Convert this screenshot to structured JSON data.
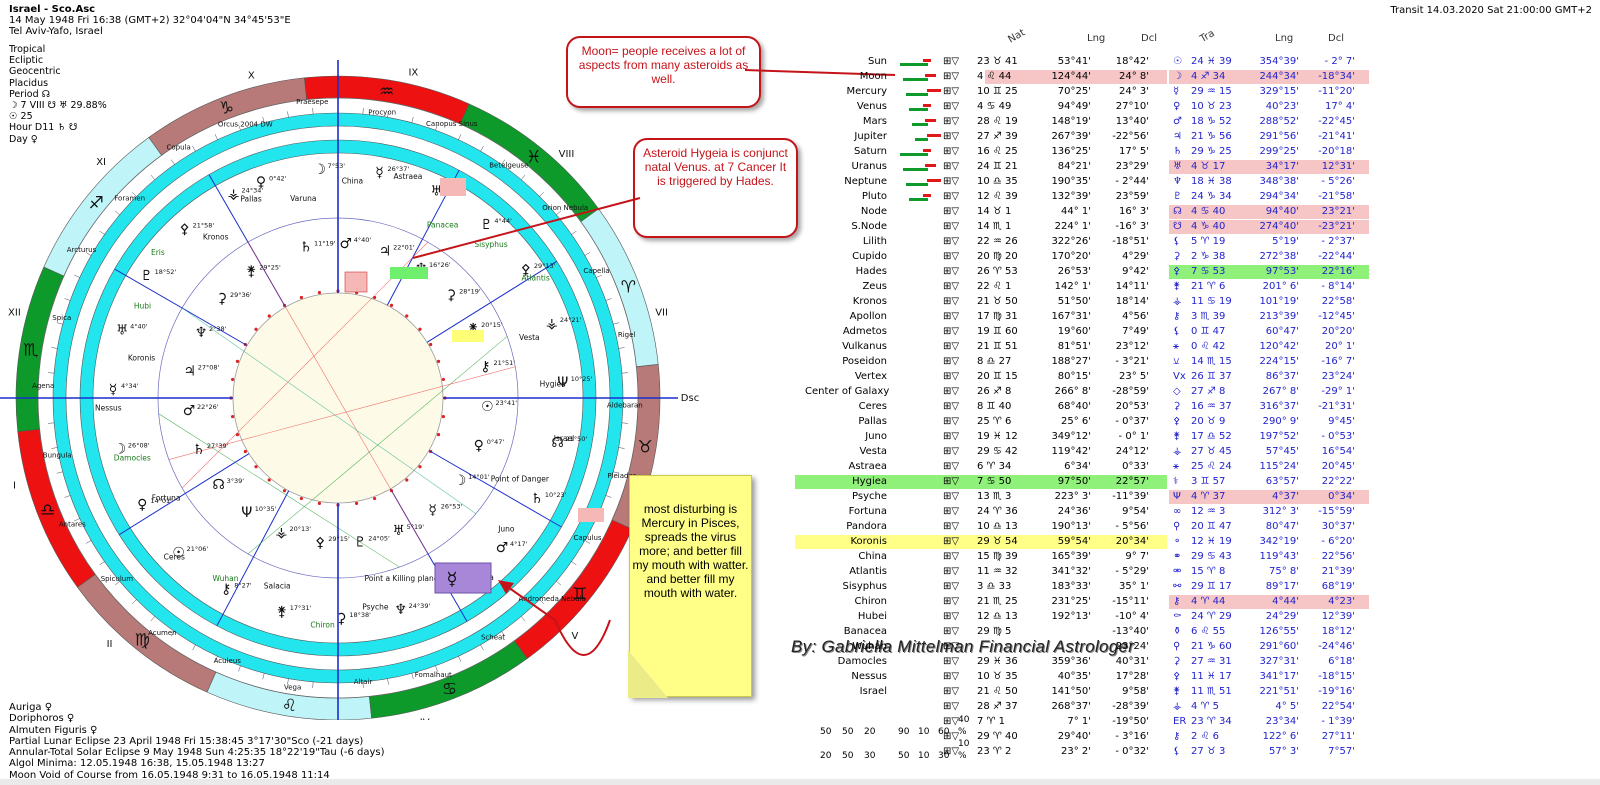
{
  "header": {
    "title": "Israel - Sco.Asc",
    "line2": "14 May 1948  Fri  16:38 (GMT+2) 32°04'04\"N  34°45'53\"E",
    "line3": "Tel Aviv-Yafo, Israel"
  },
  "info_lines": [
    "Tropical",
    "Ecliptic",
    "Geocentric",
    "Placidus",
    "Period ☊",
    "☽  7 VIII ☋ ♅ 29.88%",
    "☉  25",
    "Hour D11 ♄ ☋",
    "Day ♀"
  ],
  "transit_header": "Transit 14.03.2020   Sat 21:00:00 GMT+2",
  "bottom_info": [
    "Auriga  ♀",
    "Doriphoros  ♀",
    "Almuten Figuris  ♀",
    "Partial Lunar Eclipse 23 April 1948 Fri 15:38:45  3°17'30\"Sco (-21 days)",
    "Annular-Total Solar Eclipse 9 May 1948 Sun  4:25:35 18°22'19\"Tau (-6 days)",
    "Algol Minima: 12.05.1948 16:38,  15.05.1948 13:27",
    "Moon Void of Course from 16.05.1948  9:31 to 16.05.1948 11:14"
  ],
  "wheel": {
    "angles": {
      "mc": "MC",
      "ic": "IC",
      "asc": "Asc",
      "dsc": "Dsc"
    },
    "houses": [
      "I",
      "II",
      "III",
      "IV",
      "V",
      "VI",
      "VII",
      "VIII",
      "IX",
      "X",
      "XI",
      "XII"
    ],
    "sign_glyphs": [
      "♌",
      "♋",
      "♊",
      "♉",
      "♈",
      "♓",
      "♒",
      "♑",
      "♐",
      "♏",
      "♎",
      "♍"
    ],
    "outer_labels": [
      "Praesepe",
      "Procyon",
      "Canopus Sinus",
      "Betelgeuse",
      "Orion Nebula",
      "Capella",
      "Rigel",
      "Aldebaran",
      "Pleiades",
      "Capulus",
      "Andromeda Nebula",
      "Scheat",
      "Fomalhaut",
      "Altair",
      "Vega",
      "Aculeus",
      "Acumen",
      "Spiculum",
      "Antares",
      "Bungula",
      "Agena",
      "Spica",
      "Arcturus",
      "Foramen",
      "Copula",
      "Orcus 2004 DW"
    ],
    "inner_labels": [
      "Varuna",
      "China",
      "Astraea",
      "Panacea",
      "Sisyphus",
      "Atlantis",
      "Vesta",
      "Hygiea",
      "Israel",
      "Point of Danger",
      "Juno",
      "Pandora",
      "Point a Killing planet Anareta",
      "Psyche",
      "Chiron",
      "Salacia",
      "Wuhan",
      "Ceres",
      "Fortuna",
      "Damocles",
      "Nessus",
      "Koronis",
      "Hubi",
      "Eris",
      "Kronos",
      "Pallas"
    ],
    "planet_degrees": [
      "0°42'",
      "11°19'",
      "7°53'",
      "4°40'",
      "26°37'",
      "22°01'",
      "12°39'",
      "16°26'",
      "4°44'",
      "28°19'",
      "29°13'",
      "20°15'",
      "24°21'",
      "21°51'",
      "10°25'",
      "23°41'",
      "21°50'",
      "0°47'",
      "10°23'",
      "14°01'",
      "4°17'",
      "26°53'",
      "19°60'",
      "5°19'",
      "24°39'",
      "24°05'",
      "18°38'",
      "29°15'",
      "17°31'",
      "20°13'",
      "8°27'",
      "10°35'",
      "21°06'",
      "3°39'",
      "14°01'",
      "27°39'",
      "26°08'",
      "22°26'",
      "4°34'",
      "27°08'",
      "4°40'",
      "2°38'",
      "18°52'",
      "29°36'",
      "21°58'",
      "29°25'",
      "24°34'"
    ]
  },
  "callouts": {
    "moon": "Moon= people receives a lot of aspects from many asteroids as well.",
    "hygeia": "Asteroid Hygeia is conjunct natal Venus. at 7 Cancer It is triggered by Hades.",
    "note": "most disturbing is Mercury in Pisces, spreads the virus more; and better fill my mouth with watter. and better fill my mouth with water."
  },
  "signature": "By:  Gabriella Mittelman Financial Astrologer",
  "table": {
    "headers": {
      "nat": "Nat",
      "lng": "Lng",
      "dcl": "Dcl",
      "tra": "Tra",
      "lng2": "Lng",
      "dcl2": "Dcl"
    },
    "rows": [
      {
        "name": "Sun",
        "g": "☉",
        "natpos": "23 ♉ 41",
        "lng": "53°41'",
        "dcl": "18°42'",
        "tpos": "24 ♓ 39",
        "tlng": "354°39'",
        "tdcl": "- 2° 7'",
        "hl": "",
        "thl": ""
      },
      {
        "name": "Moon",
        "g": "☽",
        "natpos": "4 ♌ 44",
        "lng": "124°44'",
        "dcl": "24° 8'",
        "tpos": "4 ♐ 34",
        "tlng": "244°34'",
        "tdcl": "-18°34'",
        "hl": "red",
        "thl": "red"
      },
      {
        "name": "Mercury",
        "g": "☿",
        "natpos": "10 ♊ 25",
        "lng": "70°25'",
        "dcl": "24° 3'",
        "tpos": "29 ♒ 15",
        "tlng": "329°15'",
        "tdcl": "-11°20'",
        "hl": "",
        "thl": ""
      },
      {
        "name": "Venus",
        "g": "♀",
        "natpos": "4 ♋ 49",
        "lng": "94°49'",
        "dcl": "27°10'",
        "tpos": "10 ♉ 23",
        "tlng": "40°23'",
        "tdcl": "17° 4'",
        "hl": "",
        "thl": ""
      },
      {
        "name": "Mars",
        "g": "♂",
        "natpos": "28 ♌ 19",
        "lng": "148°19'",
        "dcl": "13°40'",
        "tpos": "18 ♑ 52",
        "tlng": "288°52'",
        "tdcl": "-22°45'",
        "hl": "",
        "thl": ""
      },
      {
        "name": "Jupiter",
        "g": "♃",
        "natpos": "27 ♐ 39",
        "lng": "267°39'",
        "dcl": "-22°56'",
        "tpos": "21 ♑ 56",
        "tlng": "291°56'",
        "tdcl": "-21°41'",
        "hl": "",
        "thl": ""
      },
      {
        "name": "Saturn",
        "g": "♄",
        "natpos": "16 ♌ 25",
        "lng": "136°25'",
        "dcl": "17° 5'",
        "tpos": "29 ♑ 25",
        "tlng": "299°25'",
        "tdcl": "-20°18'",
        "hl": "",
        "thl": ""
      },
      {
        "name": "Uranus",
        "g": "♅",
        "natpos": "24 ♊ 21",
        "lng": "84°21'",
        "dcl": "23°29'",
        "tpos": "4 ♉ 17",
        "tlng": "34°17'",
        "tdcl": "12°31'",
        "hl": "",
        "thl": "red"
      },
      {
        "name": "Neptune",
        "g": "♆",
        "natpos": "10 ♎ 35",
        "lng": "190°35'",
        "dcl": "- 2°44'",
        "tpos": "18 ♓ 38",
        "tlng": "348°38'",
        "tdcl": "- 5°26'",
        "hl": "",
        "thl": ""
      },
      {
        "name": "Pluto",
        "g": "♇",
        "natpos": "12 ♌ 39",
        "lng": "132°39'",
        "dcl": "23°59'",
        "tpos": "24 ♑ 34",
        "tlng": "294°34'",
        "tdcl": "-21°58'",
        "hl": "",
        "thl": ""
      },
      {
        "name": "Node",
        "g": "☊",
        "natpos": "14 ♉ 1",
        "lng": "44° 1'",
        "dcl": "16° 3'",
        "tpos": "4 ♋ 40",
        "tlng": "94°40'",
        "tdcl": "23°21'",
        "hl": "",
        "thl": "red"
      },
      {
        "name": "S.Node",
        "g": "☋",
        "natpos": "14 ♏ 1",
        "lng": "224° 1'",
        "dcl": "-16° 3'",
        "tpos": "4 ♑ 40",
        "tlng": "274°40'",
        "tdcl": "-23°21'",
        "hl": "",
        "thl": "red"
      },
      {
        "name": "Lilith",
        "g": "⚸",
        "natpos": "22 ♒ 26",
        "lng": "322°26'",
        "dcl": "-18°51'",
        "tpos": "5 ♈ 19",
        "tlng": "5°19'",
        "tdcl": "- 2°37'",
        "hl": "",
        "thl": ""
      },
      {
        "name": "Cupido",
        "g": "⚳",
        "natpos": "20 ♍ 20",
        "lng": "170°20'",
        "dcl": "4°29'",
        "tpos": "2 ♑ 38",
        "tlng": "272°38'",
        "tdcl": "-22°44'",
        "hl": "",
        "thl": ""
      },
      {
        "name": "Hades",
        "g": "⚴",
        "natpos": "26 ♈ 53",
        "lng": "26°53'",
        "dcl": "9°42'",
        "tpos": "7 ♋ 53",
        "tlng": "97°53'",
        "tdcl": "22°16'",
        "hl": "",
        "thl": "green"
      },
      {
        "name": "Zeus",
        "g": "⚵",
        "natpos": "22 ♌ 1",
        "lng": "142° 1'",
        "dcl": "14°11'",
        "tpos": "21 ♈ 6",
        "tlng": "201° 6'",
        "tdcl": "- 8°14'",
        "hl": "",
        "thl": ""
      },
      {
        "name": "Kronos",
        "g": "⚶",
        "natpos": "21 ♉ 50",
        "lng": "51°50'",
        "dcl": "18°14'",
        "tpos": "11 ♋ 19",
        "tlng": "101°19'",
        "tdcl": "22°58'",
        "hl": "",
        "thl": ""
      },
      {
        "name": "Apollon",
        "g": "⚷",
        "natpos": "17 ♍ 31",
        "lng": "167°31'",
        "dcl": "4°56'",
        "tpos": "3 ♏ 39",
        "tlng": "213°39'",
        "tdcl": "-12°45'",
        "hl": "",
        "thl": ""
      },
      {
        "name": "Admetos",
        "g": "⚸",
        "natpos": "19 ♊ 60",
        "lng": "19°60'",
        "dcl": "7°49'",
        "tpos": "0 ♊ 47",
        "tlng": "60°47'",
        "tdcl": "20°20'",
        "hl": "",
        "thl": ""
      },
      {
        "name": "Vulkanus",
        "g": "⚹",
        "natpos": "21 ♊ 51",
        "lng": "81°51'",
        "dcl": "23°12'",
        "tpos": "0 ♌ 42",
        "tlng": "120°42'",
        "tdcl": "20° 1'",
        "hl": "",
        "thl": ""
      },
      {
        "name": "Poseidon",
        "g": "⚺",
        "natpos": "8 ♎ 27",
        "lng": "188°27'",
        "dcl": "- 3°21'",
        "tpos": "14 ♏ 15",
        "tlng": "224°15'",
        "tdcl": "-16° 7'",
        "hl": "",
        "thl": ""
      },
      {
        "name": "Vertex",
        "g": "Vx",
        "natpos": "20 ♊ 15",
        "lng": "80°15'",
        "dcl": "23° 5'",
        "tpos": "26 ♊ 37",
        "tlng": "86°37'",
        "tdcl": "23°24'",
        "hl": "",
        "thl": ""
      },
      {
        "name": "Center of Galaxy",
        "g": "◇",
        "natpos": "26 ♐ 8",
        "lng": "266° 8'",
        "dcl": "-28°59'",
        "tpos": "27 ♐ 8",
        "tlng": "267° 8'",
        "tdcl": "-29° 1'",
        "hl": "",
        "thl": ""
      },
      {
        "name": "Ceres",
        "g": "⚳",
        "natpos": "8 ♊ 40",
        "lng": "68°40'",
        "dcl": "20°53'",
        "tpos": "16 ♒ 37",
        "tlng": "316°37'",
        "tdcl": "-21°31'",
        "hl": "",
        "thl": ""
      },
      {
        "name": "Pallas",
        "g": "⚴",
        "natpos": "25 ♈ 6",
        "lng": "25° 6'",
        "dcl": "- 0°37'",
        "tpos": "20 ♉ 9",
        "tlng": "290° 9'",
        "tdcl": "9°45'",
        "hl": "",
        "thl": ""
      },
      {
        "name": "Juno",
        "g": "⚵",
        "natpos": "19 ♓ 12",
        "lng": "349°12'",
        "dcl": "- 0° 1'",
        "tpos": "17 ♎ 52",
        "tlng": "197°52'",
        "tdcl": "- 0°53'",
        "hl": "",
        "thl": ""
      },
      {
        "name": "Vesta",
        "g": "⚶",
        "natpos": "29 ♋ 42",
        "lng": "119°42'",
        "dcl": "24°12'",
        "tpos": "27 ♉ 45",
        "tlng": "57°45'",
        "tdcl": "16°54'",
        "hl": "",
        "thl": ""
      },
      {
        "name": "Astraea",
        "g": "⚹",
        "natpos": "6 ♈ 34",
        "lng": "6°34'",
        "dcl": "0°33'",
        "tpos": "25 ♌ 24",
        "tlng": "115°24'",
        "tdcl": "20°45'",
        "hl": "",
        "thl": ""
      },
      {
        "name": "Hygiea",
        "g": "⚕",
        "natpos": "7 ♋ 50",
        "lng": "97°50'",
        "dcl": "22°57'",
        "tpos": "3 ♊ 57",
        "tlng": "63°57'",
        "tdcl": "22°22'",
        "hl": "green",
        "thl": ""
      },
      {
        "name": "Psyche",
        "g": "Ψ",
        "natpos": "13 ♏ 3",
        "lng": "223° 3'",
        "dcl": "-11°39'",
        "tpos": "4 ♈ 37",
        "tlng": "4°37'",
        "tdcl": "0°34'",
        "hl": "",
        "thl": "red"
      },
      {
        "name": "Fortuna",
        "g": "∞",
        "natpos": "24 ♈ 36",
        "lng": "24°36'",
        "dcl": "9°54'",
        "tpos": "12 ♒ 3",
        "tlng": "312° 3'",
        "tdcl": "-15°59'",
        "hl": "",
        "thl": ""
      },
      {
        "name": "Pandora",
        "g": "⚲",
        "natpos": "10 ♎ 13",
        "lng": "190°13'",
        "dcl": "- 5°56'",
        "tpos": "20 ♊ 47",
        "tlng": "80°47'",
        "tdcl": "30°37'",
        "hl": "",
        "thl": ""
      },
      {
        "name": "Koronis",
        "g": "⚬",
        "natpos": "29 ♉ 54",
        "lng": "59°54'",
        "dcl": "20°34'",
        "tpos": "12 ♓ 19",
        "tlng": "342°19'",
        "tdcl": "- 6°20'",
        "hl": "yellow",
        "thl": ""
      },
      {
        "name": "China",
        "g": "⚭",
        "natpos": "15 ♍ 39",
        "lng": "165°39'",
        "dcl": "9° 7'",
        "tpos": "29 ♋ 43",
        "tlng": "119°43'",
        "tdcl": "22°56'",
        "hl": "",
        "thl": ""
      },
      {
        "name": "Atlantis",
        "g": "⚮",
        "natpos": "11 ♒ 32",
        "lng": "341°32'",
        "dcl": "- 5°29'",
        "tpos": "15 ♈ 8",
        "tlng": "75° 8'",
        "tdcl": "21°39'",
        "hl": "",
        "thl": ""
      },
      {
        "name": "Sisyphus",
        "g": "⚯",
        "natpos": "3 ♎ 33",
        "lng": "183°33'",
        "dcl": "35° 1'",
        "tpos": "29 ♊ 17",
        "tlng": "89°17'",
        "tdcl": "68°19'",
        "hl": "",
        "thl": ""
      },
      {
        "name": "Chiron",
        "g": "⚷",
        "natpos": "21 ♏ 25",
        "lng": "231°25'",
        "dcl": "-15°11'",
        "tpos": "4 ♈ 44",
        "tlng": "4°44'",
        "tdcl": "4°23'",
        "hl": "",
        "thl": "red"
      },
      {
        "name": "Hubei",
        "g": "⚰",
        "natpos": "12 ♎ 13",
        "lng": "192°13'",
        "dcl": "-10° 4'",
        "tpos": "24 ♈ 29",
        "tlng": "24°29'",
        "tdcl": "12°39'",
        "hl": "",
        "thl": ""
      },
      {
        "name": "Banacea",
        "g": "⚱",
        "natpos": "29 ♍ 5",
        "lng": "",
        "dcl": "-13°40'",
        "tpos": "6 ♌ 55",
        "tlng": "126°55'",
        "tdcl": "18°12'",
        "hl": "",
        "thl": ""
      },
      {
        "name": "Wuhan",
        "g": "⚲",
        "natpos": "",
        "lng": "",
        "dcl": "23°24'",
        "tpos": "21 ♑ 60",
        "tlng": "291°60'",
        "tdcl": "-24°46'",
        "hl": "",
        "thl": ""
      },
      {
        "name": "Damocles",
        "g": "⚳",
        "natpos": "29 ♓ 36",
        "lng": "359°36'",
        "dcl": "40°31'",
        "tpos": "27 ♒ 31",
        "tlng": "327°31'",
        "tdcl": "6°18'",
        "hl": "",
        "thl": ""
      },
      {
        "name": "Nessus",
        "g": "⚴",
        "natpos": "10 ♉ 35",
        "lng": "40°35'",
        "dcl": "17°28'",
        "tpos": "11 ♓ 17",
        "tlng": "341°17'",
        "tdcl": "-18°15'",
        "hl": "",
        "thl": ""
      },
      {
        "name": "Israel",
        "g": "⚵",
        "natpos": "21 ♌ 50",
        "lng": "141°50'",
        "dcl": "9°58'",
        "tpos": "11 ♏ 51",
        "tlng": "221°51'",
        "tdcl": "-19°16'",
        "hl": "",
        "thl": ""
      },
      {
        "name": "",
        "g": "⚶",
        "natpos": "28 ♐ 37",
        "lng": "268°37'",
        "dcl": "-28°39'",
        "tpos": "4 ♈ 5",
        "tlng": "4° 5'",
        "tdcl": "22°54'",
        "hl": "",
        "thl": ""
      },
      {
        "name": "",
        "g": "ER",
        "natpos": "7 ♈ 1",
        "lng": "7° 1'",
        "dcl": "-19°50'",
        "tpos": "23 ♈ 34",
        "tlng": "23°34'",
        "tdcl": "- 1°39'",
        "hl": "",
        "thl": ""
      },
      {
        "name": "",
        "g": "⚷",
        "natpos": "29 ♈ 40",
        "lng": "29°40'",
        "dcl": "- 3°16'",
        "tpos": "2 ♌ 6",
        "tlng": "122° 6'",
        "tdcl": "27°11'",
        "hl": "",
        "thl": ""
      },
      {
        "name": "",
        "g": "⚸",
        "natpos": "23 ♈ 2",
        "lng": "23° 2'",
        "dcl": "- 0°32'",
        "tpos": "27 ♉ 3",
        "tlng": "57° 3'",
        "tdcl": "7°57'",
        "hl": "",
        "thl": ""
      }
    ]
  },
  "legend": {
    "row1": [
      "50",
      "50",
      "20",
      "90",
      "10",
      "60",
      "40 %"
    ],
    "row2": [
      "20",
      "50",
      "30",
      "50",
      "10",
      "30",
      "10 %"
    ]
  },
  "colors": {
    "red": "#ee1111",
    "green": "#0d9a2a",
    "rose": "#b77a78",
    "cyan": "#22e5ee",
    "lightcyan": "#bff4f8",
    "blue": "#1a2ecc",
    "callout": "#c4141a"
  }
}
